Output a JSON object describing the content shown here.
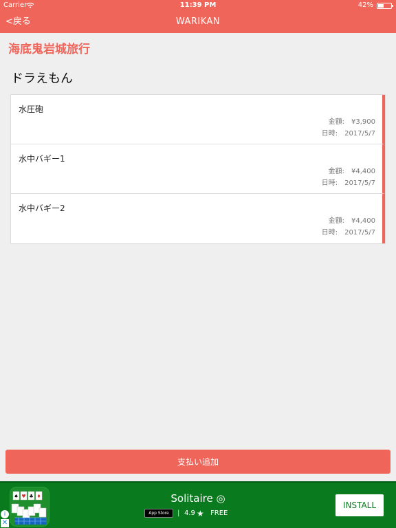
{
  "status_bar": {
    "carrier": "Carrier",
    "time": "11:39 PM",
    "battery": "42%",
    "battery_level": 0.42
  },
  "nav": {
    "back_label": "<戻る",
    "title": "WARIKAN"
  },
  "trip_title": "海底鬼岩城旅行",
  "person_name": "ドラえもん",
  "labels": {
    "amount": "金額:",
    "date": "日時:"
  },
  "payments": [
    {
      "name": "水圧砲",
      "amount": "¥3,900",
      "date": "2017/5/7"
    },
    {
      "name": "水中バギー1",
      "amount": "¥4,400",
      "date": "2017/5/7"
    },
    {
      "name": "水中バギー2",
      "amount": "¥4,400",
      "date": "2017/5/7"
    }
  ],
  "add_payment_label": "支払い追加",
  "ad": {
    "app_title": "Solitaire ◎",
    "store_badge": "App Store",
    "rating": "4.9",
    "price": "FREE",
    "install_label": "INSTALL",
    "icons": [
      "wifi-icon",
      "battery-icon",
      "solitaire-app-icon",
      "star-icon",
      "info-icon",
      "close-icon"
    ]
  },
  "colors": {
    "accent": "#f0655a",
    "ad_background": "#0a7a1e"
  }
}
